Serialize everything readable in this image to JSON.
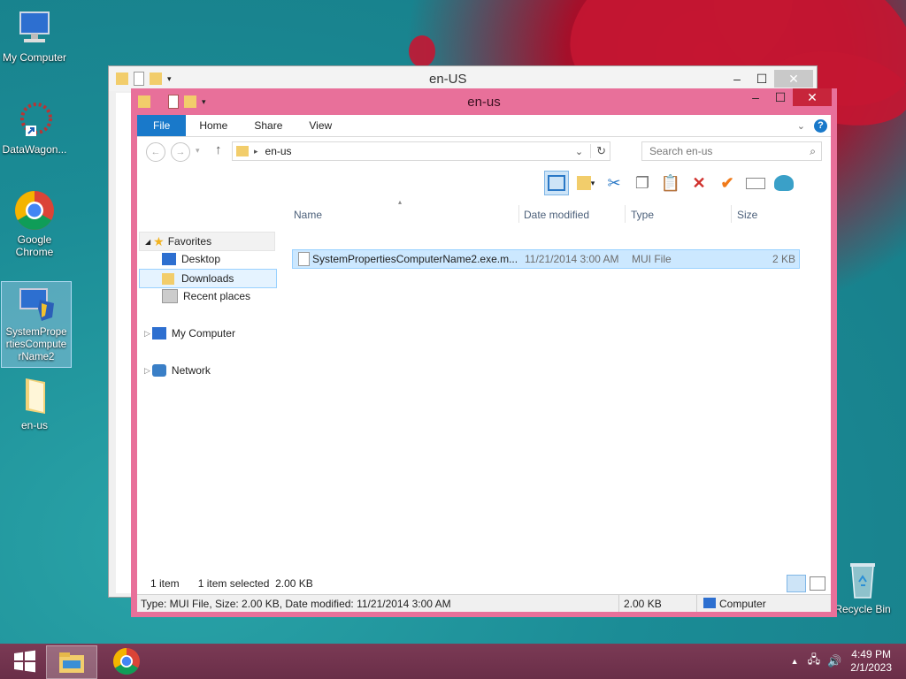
{
  "desktop": {
    "icons": [
      {
        "label": "My Computer"
      },
      {
        "label": "DataWagon..."
      },
      {
        "label": "Google Chrome"
      },
      {
        "label": "SystemPropertiesComputerName2"
      },
      {
        "label": "en-us"
      },
      {
        "label": "Recycle Bin"
      }
    ]
  },
  "back_window": {
    "title": "en-US"
  },
  "window": {
    "title": "en-us",
    "ribbon_tabs": [
      "File",
      "Home",
      "Share",
      "View"
    ],
    "address": {
      "segment": "en-us"
    },
    "search": {
      "placeholder": "Search en-us"
    },
    "nav": {
      "favorites": "Favorites",
      "desktop": "Desktop",
      "downloads": "Downloads",
      "recent": "Recent places",
      "my_computer": "My Computer",
      "network": "Network"
    },
    "columns": {
      "name": "Name",
      "date": "Date modified",
      "type": "Type",
      "size": "Size"
    },
    "files": [
      {
        "name": "SystemPropertiesComputerName2.exe.m...",
        "date": "11/21/2014 3:00 AM",
        "type": "MUI File",
        "size": "2 KB"
      }
    ],
    "status": {
      "count": "1 item",
      "selected": "1 item selected  2.00 KB"
    },
    "details_bar": {
      "info": "Type: MUI File, Size: 2.00 KB, Date modified: 11/21/2014 3:00 AM",
      "size": "2.00 KB",
      "location": "Computer"
    }
  },
  "taskbar": {
    "clock": {
      "time": "4:49 PM",
      "date": "2/1/2023"
    }
  },
  "colors": {
    "accent": "#1979ca",
    "window_frame": "#e8709a",
    "close": "#c7253b"
  }
}
